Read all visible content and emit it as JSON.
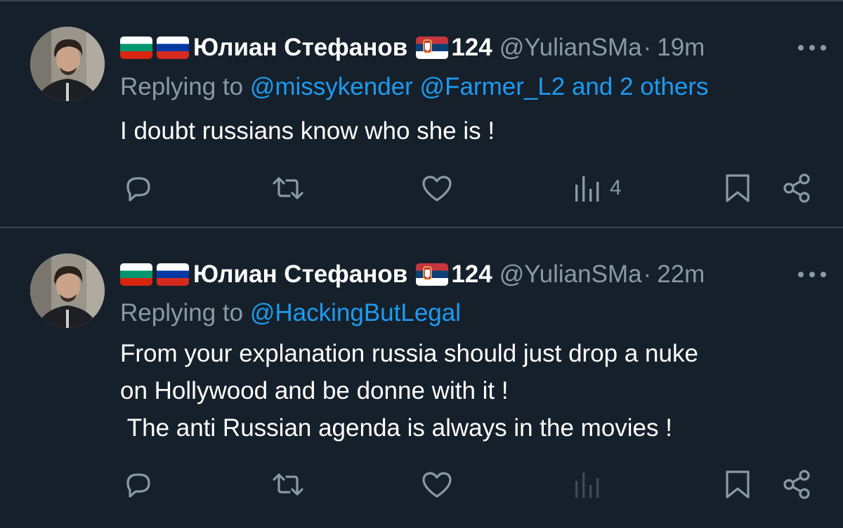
{
  "colors": {
    "background": "#15202b",
    "divider": "#38444d",
    "text_primary": "#ffffff",
    "text_secondary": "#8b98a5",
    "link": "#1d9bf0"
  },
  "tweets": [
    {
      "author_name": "Юлиан Стефанов",
      "badge_number": "124",
      "handle": "@YulianSMa",
      "separator": "·",
      "time": "19m",
      "replying_prefix": "Replying to",
      "reply_mentions": "@missykender @Farmer_L2 and 2 others",
      "text": "I doubt russians know who she is !",
      "views": "4",
      "icons": [
        "bulgaria-flag-icon",
        "russia-flag-icon",
        "serbia-flag-icon",
        "more-icon",
        "reply-icon",
        "retweet-icon",
        "like-icon",
        "views-icon",
        "bookmark-icon",
        "share-icon"
      ]
    },
    {
      "author_name": "Юлиан Стефанов",
      "badge_number": "124",
      "handle": "@YulianSMa",
      "separator": "·",
      "time": "22m",
      "replying_prefix": "Replying to",
      "reply_mentions": "@HackingButLegal",
      "text": "From your explanation russia should just drop a nuke\non Hollywood and be donne with it !\n The anti Russian agenda is always in the movies !",
      "views": "",
      "icons": [
        "bulgaria-flag-icon",
        "russia-flag-icon",
        "serbia-flag-icon",
        "more-icon",
        "reply-icon",
        "retweet-icon",
        "like-icon",
        "views-icon",
        "bookmark-icon",
        "share-icon"
      ]
    }
  ]
}
